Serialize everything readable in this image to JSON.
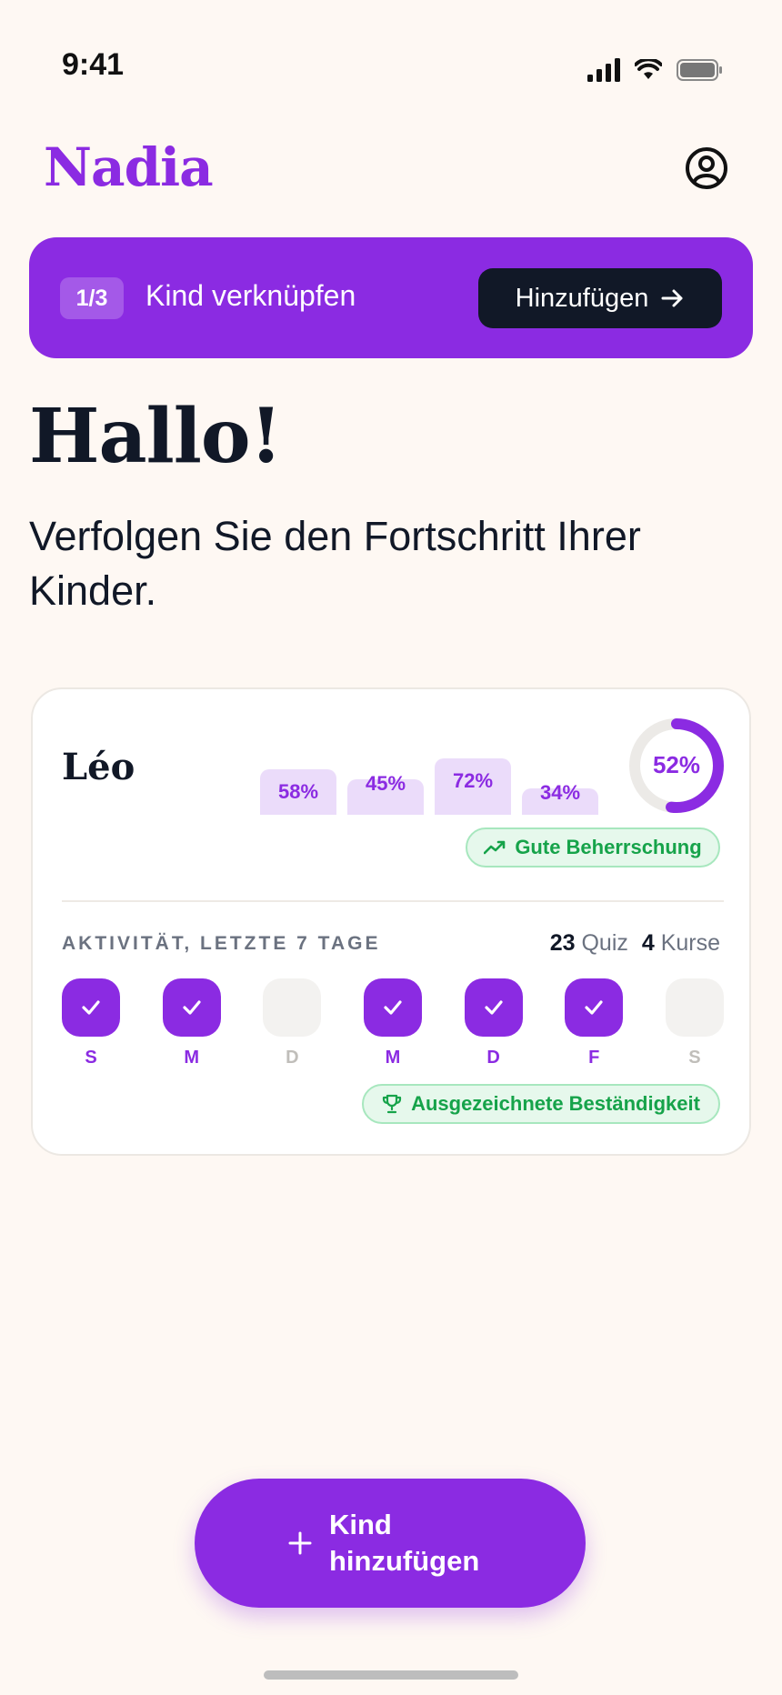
{
  "status_bar": {
    "time": "9:41"
  },
  "header": {
    "logo": "Nadia"
  },
  "banner": {
    "step": "1/3",
    "title": "Kind verknüpfen",
    "button_label": "Hinzufügen"
  },
  "greeting": {
    "title": "Hallo!",
    "subtitle": "Verfolgen Sie den Fortschritt Ihrer Kinder."
  },
  "child_card": {
    "name": "Léo",
    "subject_scores": [
      {
        "label": "58%",
        "value": 58
      },
      {
        "label": "45%",
        "value": 45
      },
      {
        "label": "72%",
        "value": 72
      },
      {
        "label": "34%",
        "value": 34
      }
    ],
    "overall": {
      "label": "52%",
      "value": 0.52
    },
    "mastery_badge": "Gute Beherrschung",
    "activity_label": "AKTIVITÄT, LETZTE 7 TAGE",
    "stats": {
      "quiz_count": "23",
      "quiz_label": "Quiz",
      "course_count": "4",
      "course_label": "Kurse"
    },
    "days": [
      {
        "letter": "S",
        "done": true
      },
      {
        "letter": "M",
        "done": true
      },
      {
        "letter": "D",
        "done": false
      },
      {
        "letter": "M",
        "done": true
      },
      {
        "letter": "D",
        "done": true
      },
      {
        "letter": "F",
        "done": true
      },
      {
        "letter": "S",
        "done": false
      }
    ],
    "consistency_badge": "Ausgezeichnete Beständigkeit"
  },
  "fab": {
    "label": "Kind hinzufügen"
  },
  "colors": {
    "accent": "#8B2BE2",
    "background": "#FEF8F3",
    "dark": "#111827",
    "success": "#16A34A",
    "bar_fill": "#EBDCFA"
  }
}
